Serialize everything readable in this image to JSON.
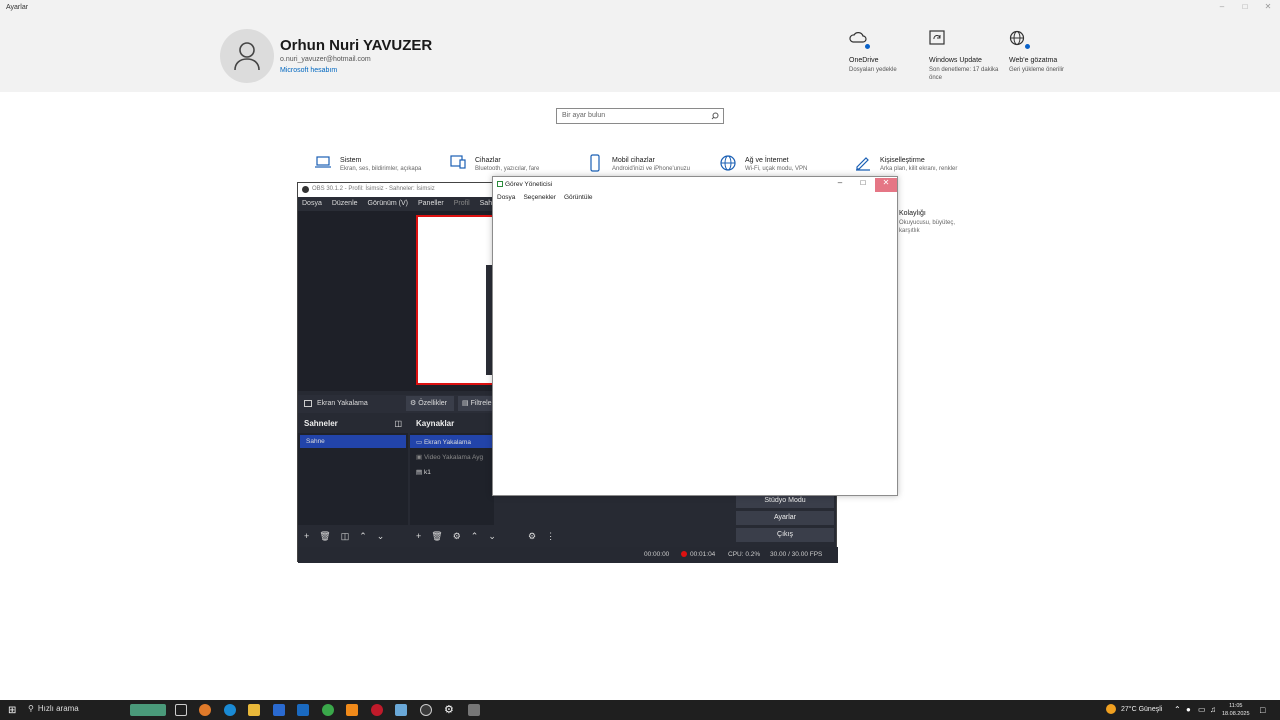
{
  "settings": {
    "window_title": "Ayarlar",
    "user": {
      "name": "Orhun Nuri YAVUZER",
      "email": "o.nuri_yavuzer@hotmail.com",
      "account_link": "Microsoft hesabım"
    },
    "quick_links": [
      {
        "icon": "cloud-icon",
        "title": "OneDrive",
        "subtitle": "Dosyaları yedekle"
      },
      {
        "icon": "update-icon",
        "title": "Windows Update",
        "subtitle": "Son denetleme: 17 dakika önce"
      },
      {
        "icon": "globe-icon",
        "title": "Web'e gözatma",
        "subtitle": "Geri yükleme önerilir"
      }
    ],
    "search_placeholder": "Bir ayar bulun",
    "categories": [
      {
        "icon": "laptop-icon",
        "title": "Sistem",
        "subtitle": "Ekran, ses, bildirimler, açıkapa"
      },
      {
        "icon": "devices-icon",
        "title": "Cihazlar",
        "subtitle": "Bluetooth, yazıcılar, fare"
      },
      {
        "icon": "phone-icon",
        "title": "Mobil cihazlar",
        "subtitle": "Android'inizi ve iPhone'unuzu"
      },
      {
        "icon": "network-icon",
        "title": "Ağ ve İnternet",
        "subtitle": "Wi-Fi, uçak modu, VPN"
      },
      {
        "icon": "personalize-icon",
        "title": "Kişiselleştirme",
        "subtitle": "Arka plan, kilit ekranı, renkler"
      }
    ],
    "accessibility": {
      "title": "Kolaylığı",
      "subtitle": "Okuyucusu, büyüteç, karşıtlık"
    }
  },
  "obs": {
    "title": "OBS 30.1.2 - Profil: İsimsiz - Sahneler: İsimsiz",
    "menu": [
      "Dosya",
      "Düzenle",
      "Görünüm (V)",
      "Paneller",
      "Profil",
      "Sahne Ko"
    ],
    "source_bar": {
      "selected": "Ekran Yakalama",
      "properties": "Özellikler",
      "filters": "Filtreler"
    },
    "scenes_header": "Sahneler",
    "scenes": [
      "Sahne"
    ],
    "sources_header": "Kaynaklar",
    "sources": [
      "Ekran Yakalama",
      "Video Yakalama Ayg",
      "k1"
    ],
    "buttons": {
      "studio": "Stüdyo Modu",
      "settings": "Ayarlar",
      "exit": "Çıkış"
    },
    "status": {
      "stream_time": "00:00:00",
      "rec_time": "00:01:04",
      "cpu": "CPU: 0.2%",
      "fps": "30.00 / 30.00 FPS"
    }
  },
  "taskmgr": {
    "title": "Görev Yöneticisi",
    "menu": [
      "Dosya",
      "Seçenekler",
      "Görüntüle"
    ]
  },
  "taskbar": {
    "search": "Hızlı arama",
    "weather": "27°C Güneşli",
    "time": "11:05",
    "date": "18.08.2025"
  }
}
